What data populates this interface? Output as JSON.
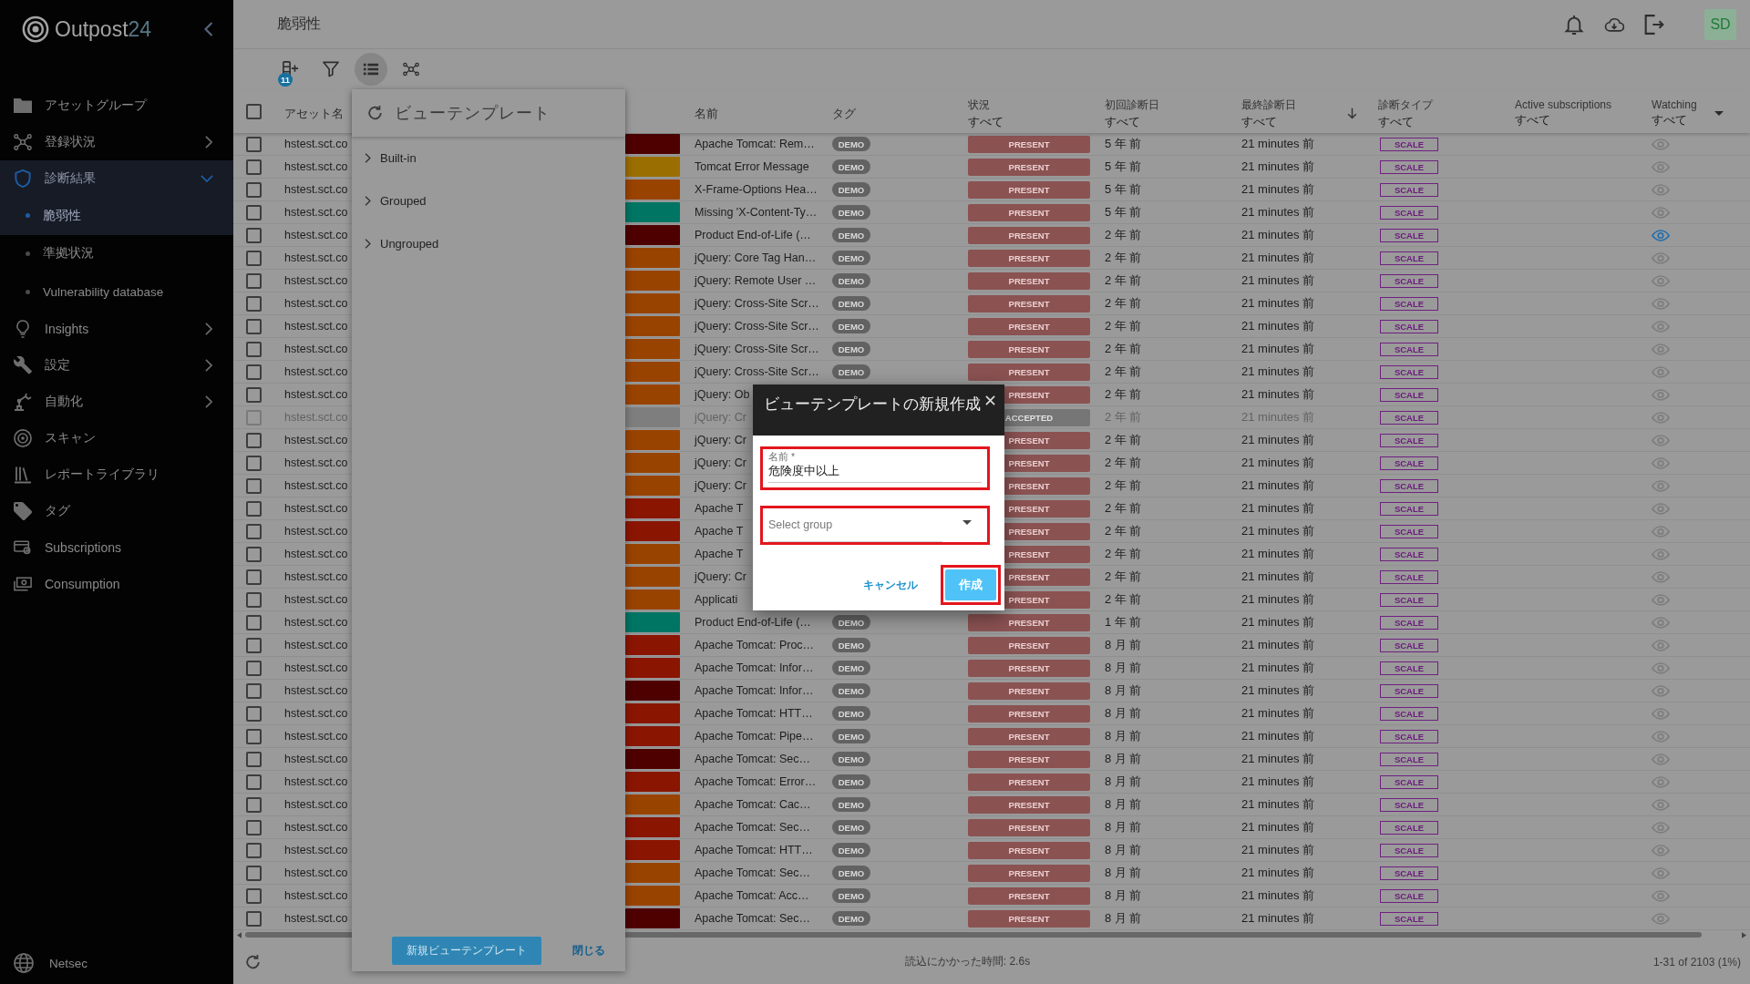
{
  "sidebar": {
    "logo": {
      "name": "Outpost",
      "suffix": "24"
    },
    "items": [
      {
        "label": "アセットグループ",
        "kind": "link",
        "selected": false
      },
      {
        "label": "登録状況",
        "kind": "group",
        "selected": false,
        "expanded": false
      },
      {
        "label": "診断結果",
        "kind": "group",
        "selected": true,
        "expanded": true,
        "children": [
          {
            "label": "脆弱性",
            "selected": true
          },
          {
            "label": "準拠状況",
            "selected": false
          },
          {
            "label": "Vulnerability database",
            "selected": false
          }
        ]
      },
      {
        "label": "Insights",
        "kind": "group",
        "selected": false,
        "expanded": false
      },
      {
        "label": "設定",
        "kind": "group",
        "selected": false,
        "expanded": false
      },
      {
        "label": "自動化",
        "kind": "group",
        "selected": false,
        "expanded": false
      },
      {
        "label": "スキャン",
        "kind": "link",
        "selected": false
      },
      {
        "label": "レポートライブラリ",
        "kind": "link",
        "selected": false
      },
      {
        "label": "タグ",
        "kind": "link",
        "selected": false
      },
      {
        "label": "Subscriptions",
        "kind": "link",
        "selected": false
      },
      {
        "label": "Consumption",
        "kind": "link",
        "selected": false
      }
    ],
    "footer": {
      "label": "Netsec"
    }
  },
  "header": {
    "title": "脆弱性",
    "avatar": "SD"
  },
  "toolbar": [
    {
      "badge": "11",
      "selected": false
    },
    {
      "selected": false
    },
    {
      "selected": true
    },
    {
      "selected": false
    }
  ],
  "table": {
    "select_all": {
      "checked": false
    },
    "columns": [
      {
        "label": "アセット名",
        "sorted": false
      },
      {
        "label": "名前",
        "sorted": false
      },
      {
        "label": "タグ",
        "sorted": false
      },
      {
        "label": "状況",
        "filter": "すべて",
        "sorted": false
      },
      {
        "label": "初回診断日",
        "filter": "すべて",
        "sorted": false
      },
      {
        "label": "最終診断日",
        "filter": "すべて",
        "sorted": true
      },
      {
        "label": "診断タイプ",
        "filter": "すべて",
        "sorted": false
      },
      {
        "label": "Active subscriptions",
        "filter": "すべて",
        "sorted": false
      },
      {
        "label": "Watching",
        "filter": "すべて",
        "sorted": false
      }
    ],
    "rows": [
      {
        "checked": false,
        "asset": "hstest.sct.co",
        "color": "#4e0000",
        "name": "Apache Tomcat: Rem…",
        "tag": "DEMO",
        "status": "PRESENT",
        "greyed": false,
        "first_seen": "5 年 前",
        "last_scan": "21 minutes 前",
        "scan_type": "SCALE",
        "watching": false
      },
      {
        "checked": false,
        "asset": "hstest.sct.co",
        "color": "#9a6e00",
        "name": "Tomcat Error Message",
        "tag": "DEMO",
        "status": "PRESENT",
        "greyed": false,
        "first_seen": "5 年 前",
        "last_scan": "21 minutes 前",
        "scan_type": "SCALE",
        "watching": false
      },
      {
        "checked": false,
        "asset": "hstest.sct.co",
        "color": "#994300",
        "name": "X-Frame-Options Hea…",
        "tag": "DEMO",
        "status": "PRESENT",
        "greyed": false,
        "first_seen": "5 年 前",
        "last_scan": "21 minutes 前",
        "scan_type": "SCALE",
        "watching": false
      },
      {
        "checked": false,
        "asset": "hstest.sct.co",
        "color": "#007563",
        "name": "Missing 'X-Content-Ty…",
        "tag": "DEMO",
        "status": "PRESENT",
        "greyed": false,
        "first_seen": "5 年 前",
        "last_scan": "21 minutes 前",
        "scan_type": "SCALE",
        "watching": false
      },
      {
        "checked": false,
        "asset": "hstest.sct.co",
        "color": "#4e0000",
        "name": "Product End-of-Life (…",
        "tag": "DEMO",
        "status": "PRESENT",
        "greyed": false,
        "first_seen": "2 年 前",
        "last_scan": "21 minutes 前",
        "scan_type": "SCALE",
        "watching": true
      },
      {
        "checked": false,
        "asset": "hstest.sct.co",
        "color": "#994300",
        "name": "jQuery: Core Tag Han…",
        "tag": "DEMO",
        "status": "PRESENT",
        "greyed": false,
        "first_seen": "2 年 前",
        "last_scan": "21 minutes 前",
        "scan_type": "SCALE",
        "watching": false
      },
      {
        "checked": false,
        "asset": "hstest.sct.co",
        "color": "#994300",
        "name": "jQuery: Remote User …",
        "tag": "DEMO",
        "status": "PRESENT",
        "greyed": false,
        "first_seen": "2 年 前",
        "last_scan": "21 minutes 前",
        "scan_type": "SCALE",
        "watching": false
      },
      {
        "checked": false,
        "asset": "hstest.sct.co",
        "color": "#994300",
        "name": "jQuery: Cross-Site Scr…",
        "tag": "DEMO",
        "status": "PRESENT",
        "greyed": false,
        "first_seen": "2 年 前",
        "last_scan": "21 minutes 前",
        "scan_type": "SCALE",
        "watching": false
      },
      {
        "checked": false,
        "asset": "hstest.sct.co",
        "color": "#994300",
        "name": "jQuery: Cross-Site Scr…",
        "tag": "DEMO",
        "status": "PRESENT",
        "greyed": false,
        "first_seen": "2 年 前",
        "last_scan": "21 minutes 前",
        "scan_type": "SCALE",
        "watching": false
      },
      {
        "checked": false,
        "asset": "hstest.sct.co",
        "color": "#994300",
        "name": "jQuery: Cross-Site Scr…",
        "tag": "DEMO",
        "status": "PRESENT",
        "greyed": false,
        "first_seen": "2 年 前",
        "last_scan": "21 minutes 前",
        "scan_type": "SCALE",
        "watching": false
      },
      {
        "checked": false,
        "asset": "hstest.sct.co",
        "color": "#994300",
        "name": "jQuery: Cross-Site Scr…",
        "tag": "DEMO",
        "status": "PRESENT",
        "greyed": false,
        "first_seen": "2 年 前",
        "last_scan": "21 minutes 前",
        "scan_type": "SCALE",
        "watching": false
      },
      {
        "checked": false,
        "asset": "hstest.sct.co",
        "color": "#994300",
        "name": "jQuery: Ob",
        "status": "PRESENT",
        "greyed": false,
        "first_seen": "2 年 前",
        "last_scan": "21 minutes 前",
        "scan_type": "SCALE",
        "watching": false
      },
      {
        "checked": false,
        "asset": "hstest.sct.co",
        "color": "#7e7e7e",
        "name": "jQuery: Cr",
        "status": "ACCEPTED",
        "greyed": true,
        "first_seen": "2 年 前",
        "last_scan": "21 minutes 前",
        "scan_type": "SCALE",
        "watching": false
      },
      {
        "checked": false,
        "asset": "hstest.sct.co",
        "color": "#994300",
        "name": "jQuery: Cr",
        "status": "PRESENT",
        "greyed": false,
        "first_seen": "2 年 前",
        "last_scan": "21 minutes 前",
        "scan_type": "SCALE",
        "watching": false
      },
      {
        "checked": false,
        "asset": "hstest.sct.co",
        "color": "#994300",
        "name": "jQuery: Cr",
        "status": "PRESENT",
        "greyed": false,
        "first_seen": "2 年 前",
        "last_scan": "21 minutes 前",
        "scan_type": "SCALE",
        "watching": false
      },
      {
        "checked": false,
        "asset": "hstest.sct.co",
        "color": "#994300",
        "name": "jQuery: Cr",
        "status": "PRESENT",
        "greyed": false,
        "first_seen": "2 年 前",
        "last_scan": "21 minutes 前",
        "scan_type": "SCALE",
        "watching": false
      },
      {
        "checked": false,
        "asset": "hstest.sct.co",
        "color": "#8a1500",
        "name": "Apache T",
        "status": "PRESENT",
        "greyed": false,
        "first_seen": "2 年 前",
        "last_scan": "21 minutes 前",
        "scan_type": "SCALE",
        "watching": false
      },
      {
        "checked": false,
        "asset": "hstest.sct.co",
        "color": "#8a1500",
        "name": "Apache T",
        "status": "PRESENT",
        "greyed": false,
        "first_seen": "2 年 前",
        "last_scan": "21 minutes 前",
        "scan_type": "SCALE",
        "watching": false
      },
      {
        "checked": false,
        "asset": "hstest.sct.co",
        "color": "#994300",
        "name": "Apache T",
        "status": "PRESENT",
        "greyed": false,
        "first_seen": "2 年 前",
        "last_scan": "21 minutes 前",
        "scan_type": "SCALE",
        "watching": false
      },
      {
        "checked": false,
        "asset": "hstest.sct.co",
        "color": "#994300",
        "name": "jQuery: Cr",
        "status": "PRESENT",
        "greyed": false,
        "first_seen": "2 年 前",
        "last_scan": "21 minutes 前",
        "scan_type": "SCALE",
        "watching": false
      },
      {
        "checked": false,
        "asset": "hstest.sct.co",
        "color": "#994300",
        "name": "Applicati",
        "status": "PRESENT",
        "greyed": false,
        "first_seen": "2 年 前",
        "last_scan": "21 minutes 前",
        "scan_type": "SCALE",
        "watching": false
      },
      {
        "checked": false,
        "asset": "hstest.sct.co",
        "color": "#007563",
        "name": "Product End-of-Life (…",
        "tag": "DEMO",
        "status": "PRESENT",
        "greyed": false,
        "first_seen": "1 年 前",
        "last_scan": "21 minutes 前",
        "scan_type": "SCALE",
        "watching": false
      },
      {
        "checked": false,
        "asset": "hstest.sct.co",
        "color": "#8a1500",
        "name": "Apache Tomcat: Proc…",
        "tag": "DEMO",
        "status": "PRESENT",
        "greyed": false,
        "first_seen": "8 月 前",
        "last_scan": "21 minutes 前",
        "scan_type": "SCALE",
        "watching": false
      },
      {
        "checked": false,
        "asset": "hstest.sct.co",
        "color": "#8a1500",
        "name": "Apache Tomcat: Infor…",
        "tag": "DEMO",
        "status": "PRESENT",
        "greyed": false,
        "first_seen": "8 月 前",
        "last_scan": "21 minutes 前",
        "scan_type": "SCALE",
        "watching": false
      },
      {
        "checked": false,
        "asset": "hstest.sct.co",
        "color": "#4e0000",
        "name": "Apache Tomcat: Infor…",
        "tag": "DEMO",
        "status": "PRESENT",
        "greyed": false,
        "first_seen": "8 月 前",
        "last_scan": "21 minutes 前",
        "scan_type": "SCALE",
        "watching": false
      },
      {
        "checked": false,
        "asset": "hstest.sct.co",
        "color": "#8a1500",
        "name": "Apache Tomcat: HTT…",
        "tag": "DEMO",
        "status": "PRESENT",
        "greyed": false,
        "first_seen": "8 月 前",
        "last_scan": "21 minutes 前",
        "scan_type": "SCALE",
        "watching": false
      },
      {
        "checked": false,
        "asset": "hstest.sct.co",
        "color": "#8a1500",
        "name": "Apache Tomcat: Pipe…",
        "tag": "DEMO",
        "status": "PRESENT",
        "greyed": false,
        "first_seen": "8 月 前",
        "last_scan": "21 minutes 前",
        "scan_type": "SCALE",
        "watching": false
      },
      {
        "checked": false,
        "asset": "hstest.sct.co",
        "color": "#4e0000",
        "name": "Apache Tomcat: Sec…",
        "tag": "DEMO",
        "status": "PRESENT",
        "greyed": false,
        "first_seen": "8 月 前",
        "last_scan": "21 minutes 前",
        "scan_type": "SCALE",
        "watching": false
      },
      {
        "checked": false,
        "asset": "hstest.sct.co",
        "color": "#8a1500",
        "name": "Apache Tomcat: Error…",
        "tag": "DEMO",
        "status": "PRESENT",
        "greyed": false,
        "first_seen": "8 月 前",
        "last_scan": "21 minutes 前",
        "scan_type": "SCALE",
        "watching": false
      },
      {
        "checked": false,
        "asset": "hstest.sct.co",
        "color": "#994300",
        "name": "Apache Tomcat: Cac…",
        "tag": "DEMO",
        "status": "PRESENT",
        "greyed": false,
        "first_seen": "8 月 前",
        "last_scan": "21 minutes 前",
        "scan_type": "SCALE",
        "watching": false
      },
      {
        "checked": false,
        "asset": "hstest.sct.co",
        "color": "#8a1500",
        "name": "Apache Tomcat: Sec…",
        "tag": "DEMO",
        "status": "PRESENT",
        "greyed": false,
        "first_seen": "8 月 前",
        "last_scan": "21 minutes 前",
        "scan_type": "SCALE",
        "watching": false
      },
      {
        "checked": false,
        "asset": "hstest.sct.co",
        "color": "#8a1500",
        "name": "Apache Tomcat: HTT…",
        "tag": "DEMO",
        "status": "PRESENT",
        "greyed": false,
        "first_seen": "8 月 前",
        "last_scan": "21 minutes 前",
        "scan_type": "SCALE",
        "watching": false
      },
      {
        "checked": false,
        "asset": "hstest.sct.co",
        "color": "#994300",
        "name": "Apache Tomcat: Sec…",
        "tag": "DEMO",
        "status": "PRESENT",
        "greyed": false,
        "first_seen": "8 月 前",
        "last_scan": "21 minutes 前",
        "scan_type": "SCALE",
        "watching": false
      },
      {
        "checked": false,
        "asset": "hstest.sct.co",
        "color": "#994300",
        "name": "Apache Tomcat: Acc…",
        "tag": "DEMO",
        "status": "PRESENT",
        "greyed": false,
        "first_seen": "8 月 前",
        "last_scan": "21 minutes 前",
        "scan_type": "SCALE",
        "watching": false
      },
      {
        "checked": false,
        "asset": "hstest.sct.co",
        "color": "#4e0000",
        "name": "Apache Tomcat: Sec…",
        "tag": "DEMO",
        "status": "PRESENT",
        "greyed": false,
        "first_seen": "8 月 前",
        "last_scan": "21 minutes 前",
        "scan_type": "SCALE",
        "watching": false
      }
    ]
  },
  "view_template_panel": {
    "title": "ビューテンプレート",
    "groups": [
      {
        "label": "Built-in",
        "expanded": false
      },
      {
        "label": "Grouped",
        "expanded": false
      },
      {
        "label": "Ungrouped",
        "expanded": false
      }
    ],
    "create_button": "新規ビューテンプレート",
    "close_button": "閉じる"
  },
  "dialog": {
    "title": "ビューテンプレートの新規作成",
    "name_field": {
      "label": "名前 *",
      "value": "危険度中以上",
      "highlighted": true
    },
    "group_field": {
      "placeholder": "Select group",
      "highlighted": true
    },
    "cancel_button": "キャンセル",
    "create_button": {
      "label": "作成",
      "highlighted": true
    }
  },
  "status_bar": {
    "load_time": "読込にかかった時間: 2.6s",
    "range": "1-31 of 2103 (1%)"
  }
}
